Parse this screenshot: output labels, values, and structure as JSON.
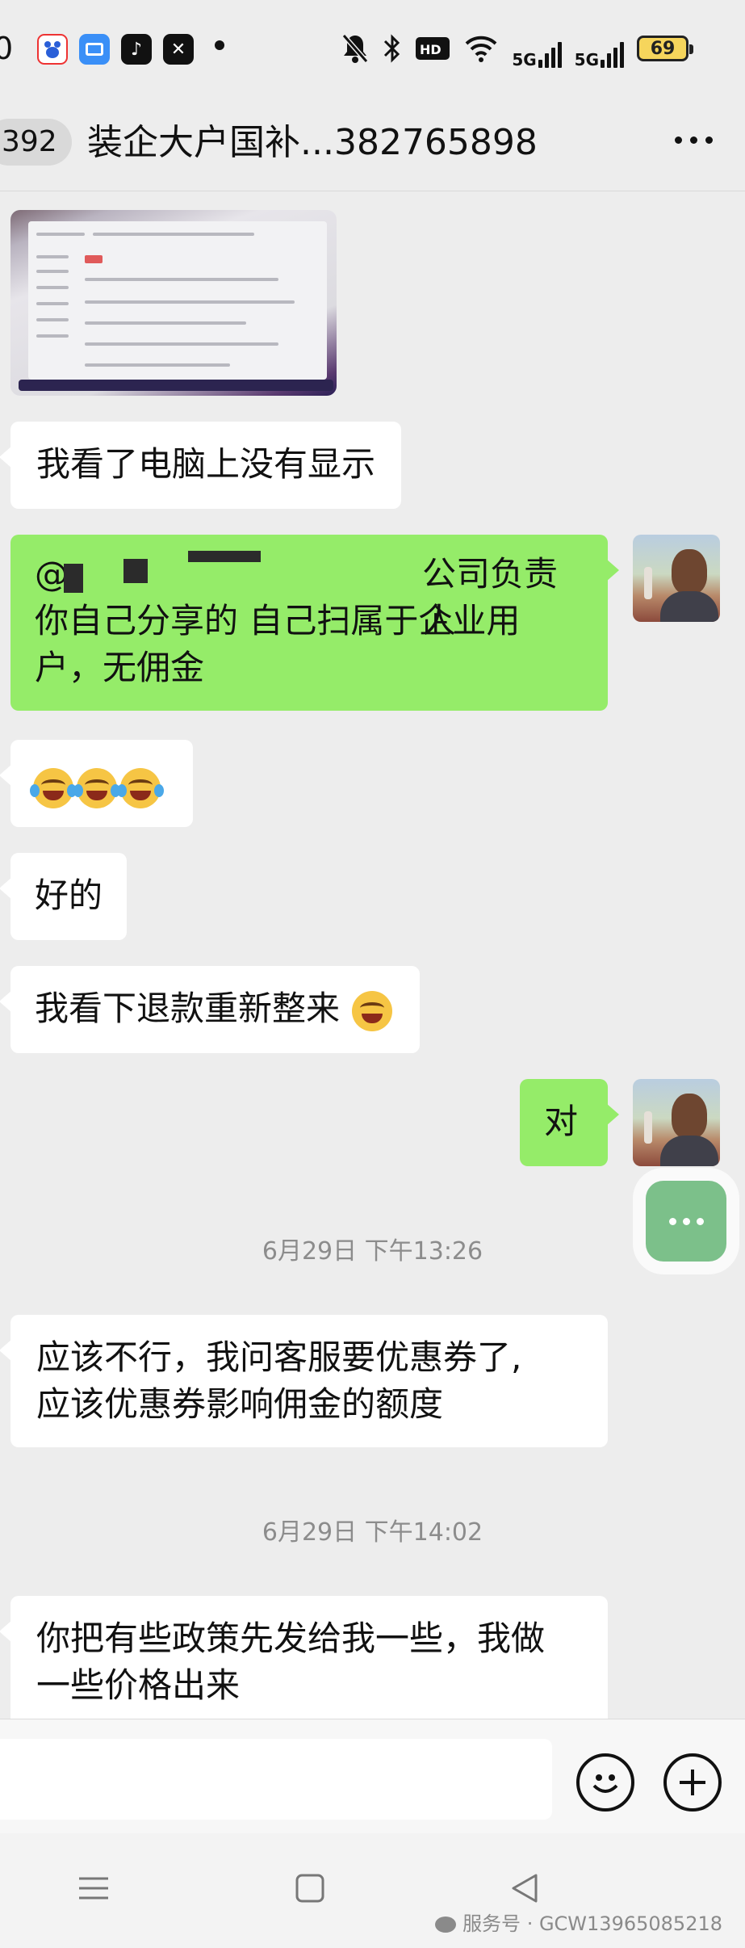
{
  "status_bar": {
    "time": "0",
    "battery": "69",
    "network": "5G",
    "apps": [
      "baidu-app-icon",
      "files-app-icon",
      "tiktok-app-icon",
      "capcut-app-icon"
    ]
  },
  "header": {
    "unread_count": "392",
    "title": "装企大户国补...382765898"
  },
  "messages": [
    {
      "side": "left",
      "type": "image"
    },
    {
      "side": "left",
      "text": "我看了电脑上没有显示"
    },
    {
      "side": "right",
      "line1": "@",
      "line1_tail": "公司负责人",
      "line2": "你自己分享的 自己扫属于企业用",
      "line3": "户，无佣金"
    },
    {
      "side": "left",
      "text": ""
    },
    {
      "side": "left",
      "text": "好的"
    },
    {
      "side": "left",
      "text": "我看下退款重新整来"
    },
    {
      "side": "right",
      "text": "对"
    },
    {
      "type": "timestamp",
      "text": "6月29日 下午13:26"
    },
    {
      "side": "left",
      "line1": "应该不行，我问客服要优惠券了,",
      "line2": "应该优惠券影响佣金的额度"
    },
    {
      "type": "timestamp",
      "text": "6月29日 下午14:02"
    },
    {
      "side": "left",
      "line1": "你把有些政策先发给我一些，我做",
      "line2": "一些价格出来"
    }
  ],
  "input": {
    "placeholder": ""
  },
  "watermark": "服务号 · GCW13965085218",
  "colors": {
    "bubble_green": "#95ec69",
    "background": "#ededed",
    "bubble_white": "#ffffff"
  }
}
